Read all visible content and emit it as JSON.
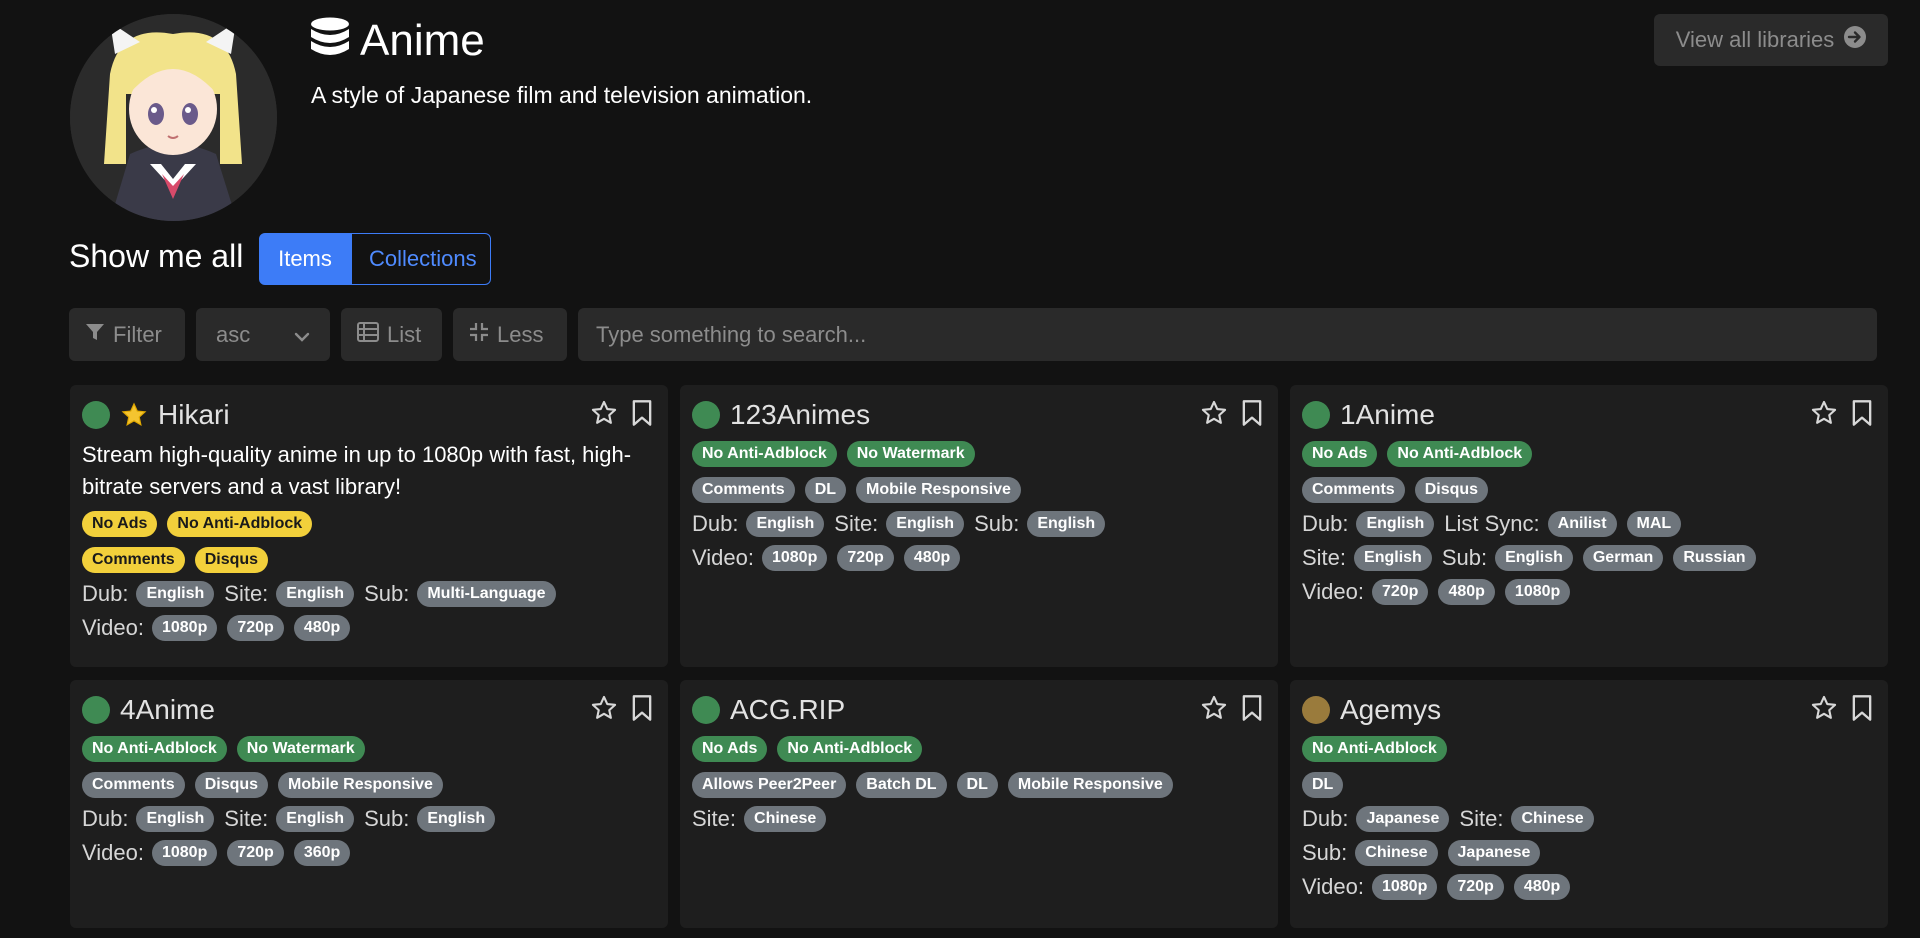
{
  "header": {
    "title": "Anime",
    "description": "A style of Japanese film and television animation.",
    "view_all": "View all libraries"
  },
  "show": {
    "label": "Show me all",
    "items": "Items",
    "collections": "Collections"
  },
  "toolbar": {
    "filter": "Filter",
    "sort": "asc",
    "list": "List",
    "less": "Less",
    "search_placeholder": "Type something to search..."
  },
  "cards": [
    {
      "name": "Hikari",
      "featured": true,
      "status": "green",
      "description": "Stream high-quality anime in up to 1080p with fast, high-bitrate servers and a vast library!",
      "tag_style": "yellow",
      "tags1": [
        "No Ads",
        "No Anti-Adblock"
      ],
      "tags2": [
        "Comments",
        "Disqus"
      ],
      "rows": [
        [
          [
            "Dub:",
            [
              "English"
            ]
          ],
          [
            "Site:",
            [
              "English"
            ]
          ],
          [
            "Sub:",
            [
              "Multi-Language"
            ]
          ]
        ],
        [
          [
            "Video:",
            [
              "1080p",
              "720p",
              "480p"
            ]
          ]
        ]
      ]
    },
    {
      "name": "123Animes",
      "featured": false,
      "status": "green",
      "description": "",
      "tag_style": "green",
      "tags1": [
        "No Anti-Adblock",
        "No Watermark"
      ],
      "tags2": [
        "Comments",
        "DL",
        "Mobile Responsive"
      ],
      "rows": [
        [
          [
            "Dub:",
            [
              "English"
            ]
          ],
          [
            "Site:",
            [
              "English"
            ]
          ],
          [
            "Sub:",
            [
              "English"
            ]
          ]
        ],
        [
          [
            "Video:",
            [
              "1080p",
              "720p",
              "480p"
            ]
          ]
        ]
      ]
    },
    {
      "name": "1Anime",
      "featured": false,
      "status": "green",
      "description": "",
      "tag_style": "green",
      "tags1": [
        "No Ads",
        "No Anti-Adblock"
      ],
      "tags2": [
        "Comments",
        "Disqus"
      ],
      "rows": [
        [
          [
            "Dub:",
            [
              "English"
            ]
          ],
          [
            "List Sync:",
            [
              "Anilist",
              "MAL"
            ]
          ]
        ],
        [
          [
            "Site:",
            [
              "English"
            ]
          ],
          [
            "Sub:",
            [
              "English",
              "German",
              "Russian"
            ]
          ]
        ],
        [
          [
            "Video:",
            [
              "720p",
              "480p",
              "1080p"
            ]
          ]
        ]
      ]
    },
    {
      "name": "4Anime",
      "featured": false,
      "status": "green",
      "description": "",
      "tag_style": "green",
      "tags1": [
        "No Anti-Adblock",
        "No Watermark"
      ],
      "tags2": [
        "Comments",
        "Disqus",
        "Mobile Responsive"
      ],
      "rows": [
        [
          [
            "Dub:",
            [
              "English"
            ]
          ],
          [
            "Site:",
            [
              "English"
            ]
          ],
          [
            "Sub:",
            [
              "English"
            ]
          ]
        ],
        [
          [
            "Video:",
            [
              "1080p",
              "720p",
              "360p"
            ]
          ]
        ]
      ]
    },
    {
      "name": "ACG.RIP",
      "featured": false,
      "status": "green",
      "description": "",
      "tag_style": "green",
      "tags1": [
        "No Ads",
        "No Anti-Adblock"
      ],
      "tags2": [
        "Allows Peer2Peer",
        "Batch DL",
        "DL",
        "Mobile Responsive"
      ],
      "rows": [
        [
          [
            "Site:",
            [
              "Chinese"
            ]
          ]
        ]
      ]
    },
    {
      "name": "Agemys",
      "featured": false,
      "status": "yellow",
      "description": "",
      "tag_style": "green",
      "tags1": [
        "No Anti-Adblock"
      ],
      "tags2": [
        "DL"
      ],
      "rows": [
        [
          [
            "Dub:",
            [
              "Japanese"
            ]
          ],
          [
            "Site:",
            [
              "Chinese"
            ]
          ]
        ],
        [
          [
            "Sub:",
            [
              "Chinese",
              "Japanese"
            ]
          ]
        ],
        [
          [
            "Video:",
            [
              "1080p",
              "720p",
              "480p"
            ]
          ]
        ]
      ]
    }
  ],
  "colors": {
    "accent": "#3d7cf7",
    "status_green": "#3f8a53",
    "status_yellow": "#9a7b3c",
    "tag_yellow": "#f2d03b",
    "tag_gray": "#6e757c"
  }
}
